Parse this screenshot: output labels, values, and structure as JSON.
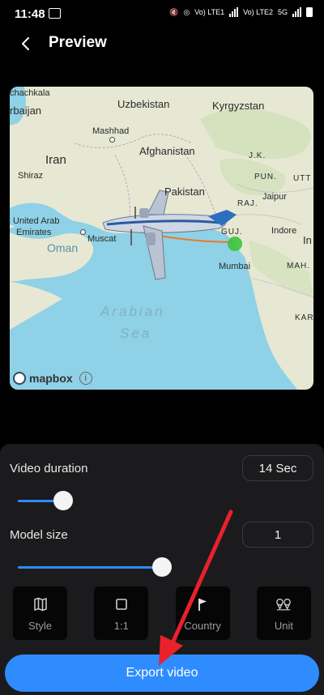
{
  "status_bar": {
    "time": "11:48",
    "lte1": "Vo) LTE1",
    "lte2": "Vo) LTE2",
    "net": "5G"
  },
  "header": {
    "title": "Preview"
  },
  "map": {
    "labels": {
      "makhachkala": "chachkala",
      "azerbaijan": "rbaijan",
      "uzbekistan": "Uzbekistan",
      "kyrgyzstan": "Kyrgyzstan",
      "mashhad": "Mashhad",
      "iran": "Iran",
      "afghanistan": "Afghanistan",
      "jk": "J.K.",
      "shiraz": "Shiraz",
      "pun": "PUN.",
      "utt": "UTT",
      "pakistan": "Pakistan",
      "jaipur": "Jaipur",
      "raj": "RAJ.",
      "uae1": "United Arab",
      "uae2": "Emirates",
      "muscat": "Muscat",
      "guj": "GUJ.",
      "indore": "Indore",
      "in": "In",
      "oman": "Oman",
      "mumbai": "Mumbai",
      "mah": "MAH.",
      "arabian": "Arabian",
      "sea": "Sea",
      "kar": "KAR"
    },
    "brand": "mapbox",
    "info": "i"
  },
  "controls": {
    "duration_label": "Video duration",
    "duration_value": "14 Sec",
    "duration_slider": 0.17,
    "model_label": "Model size",
    "model_value": "1",
    "model_slider": 0.54
  },
  "tools": [
    {
      "label": "Style",
      "icon": "map-icon"
    },
    {
      "label": "1:1",
      "icon": "square-icon"
    },
    {
      "label": "Country",
      "icon": "flag-icon"
    },
    {
      "label": "Unit",
      "icon": "pin-icon"
    }
  ],
  "export_label": "Export video",
  "colors": {
    "accent": "#2f8cff",
    "panel": "#1b1b1d",
    "arrow": "#e8212b",
    "route": "#e87a2a",
    "marker": "#3bc43b"
  }
}
